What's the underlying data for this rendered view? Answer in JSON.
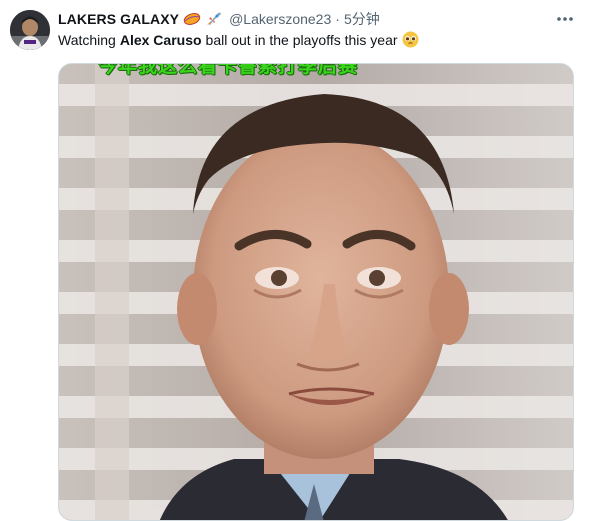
{
  "tweet": {
    "display_name": "LAKERS GALAXY",
    "name_emojis": [
      "basketball-icon",
      "rocket-icon"
    ],
    "handle": "@Lakerszone23",
    "separator": "·",
    "time": "5分钟",
    "text_before": "Watching",
    "text_mention": "Alex Caruso",
    "text_after": "ball out in the playoffs this year",
    "text_emoji": "pleading-face-icon",
    "more_icon": "more-horizontal-icon"
  },
  "media": {
    "caption": "今年我这么看卡鲁索打季后赛",
    "description_icon": "crying-man-meme-image"
  },
  "colors": {
    "accent_green": "#3bd61c",
    "muted_text": "#536471",
    "border": "#cfd9de"
  }
}
